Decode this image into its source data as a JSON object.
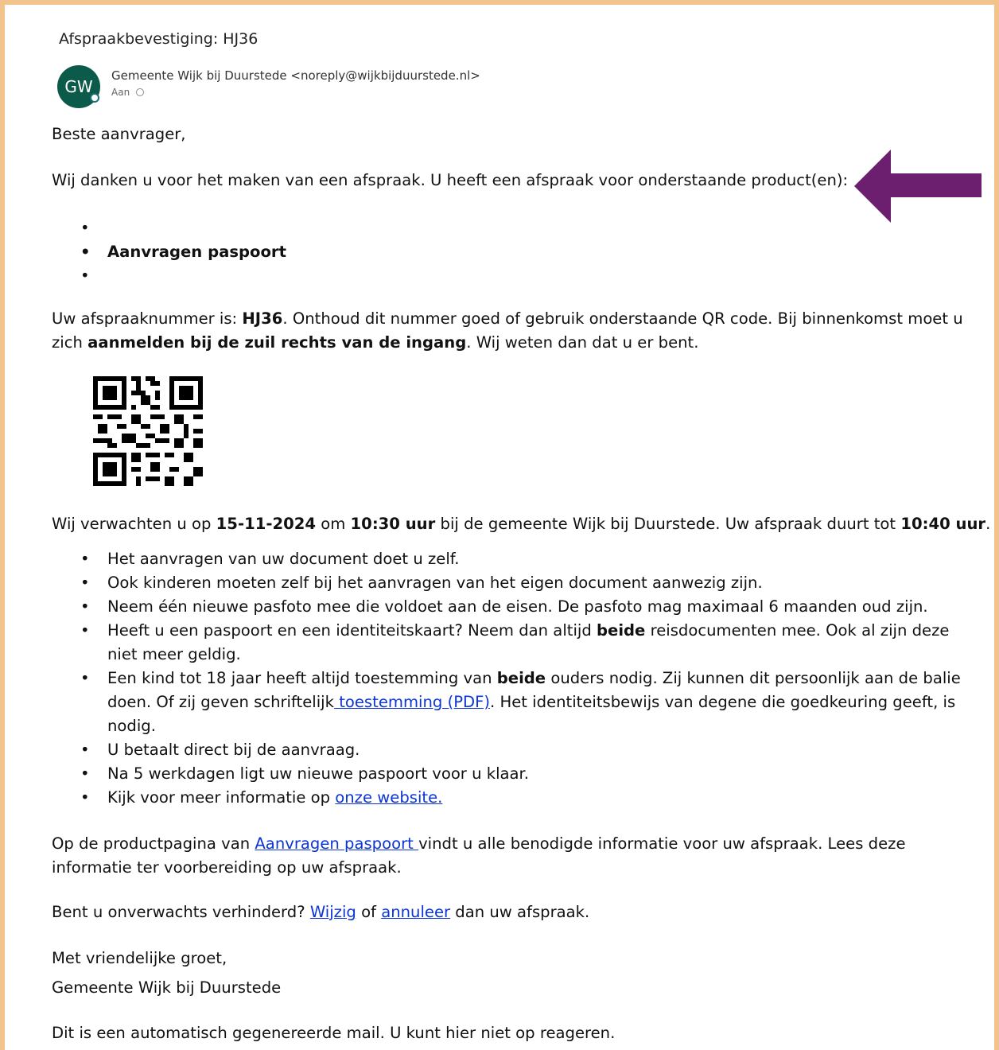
{
  "email": {
    "subject": "Afspraakbevestiging: HJ36",
    "avatar_initials": "GW",
    "sender": "Gemeente Wijk bij Duurstede <noreply@wijkbijduurstede.nl>",
    "to_label": "Aan"
  },
  "body": {
    "greeting": "Beste aanvrager,",
    "thanks": "Wij danken u voor het maken van een afspraak. U heeft een afspraak voor onderstaande product(en):",
    "products": [
      "",
      "Aanvragen paspoort",
      ""
    ],
    "nummer": {
      "part1": "Uw afspraaknummer is: ",
      "code": "HJ36",
      "part2": ". Onthoud dit nummer goed of gebruik onderstaande QR code. Bij binnenkomst moet u zich ",
      "bold": "aanmelden bij de zuil rechts van de ingang",
      "part3": ". Wij weten dan dat u er bent."
    },
    "verwacht": {
      "part1": "Wij verwachten u op ",
      "date": "15-11-2024",
      "part2": " om ",
      "time": "10:30 uur",
      "part3": " bij de gemeente Wijk bij Duurstede. Uw afspraak duurt tot ",
      "end_time": "10:40 uur",
      "part4": "."
    },
    "info_items": {
      "item1": "Het aanvragen van uw document doet u zelf.",
      "item2": "Ook kinderen moeten zelf bij het aanvragen van het eigen document aanwezig zijn.",
      "item3": "Neem één nieuwe pasfoto mee die voldoet aan de eisen. De pasfoto mag maximaal 6 maanden oud zijn.",
      "item4_a": "Heeft u een paspoort en een identiteitskaart? Neem dan altijd ",
      "item4_bold": "beide",
      "item4_b": " reisdocumenten mee. Ook al zijn deze niet meer geldig.",
      "item5_a": "Een kind tot 18 jaar heeft altijd toestemming van ",
      "item5_bold": "beide",
      "item5_b": " ouders nodig. Zij kunnen dit persoonlijk aan de balie doen. Of zij geven schriftelijk",
      "item5_link": " toestemming (PDF)",
      "item5_c": ". Het identiteitsbewijs van degene die goedkeuring geeft, is nodig.",
      "item6": "U betaalt direct bij de aanvraag.",
      "item7": "Na 5 werkdagen ligt uw nieuwe paspoort voor u klaar.",
      "item8_a": "Kijk voor meer informatie op ",
      "item8_link": "onze website."
    },
    "productpagina": {
      "part1": "Op de productpagina van ",
      "link": "Aanvragen paspoort ",
      "part2": "vindt u alle benodigde informatie voor uw afspraak. Lees deze informatie ter voorbereiding op uw afspraak."
    },
    "verhinderd": {
      "part1": "Bent u onverwachts verhinderd? ",
      "link_wijzig": "Wijzig",
      "part2": " of ",
      "link_annuleer": "annuleer",
      "part3": " dan uw afspraak."
    },
    "closing": "Met vriendelijke groet,",
    "signature": "Gemeente Wijk bij Duurstede",
    "auto_note": "Dit is een automatisch gegenereerde mail. U kunt hier niet op reageren."
  },
  "colors": {
    "frame_border": "#f2c48c",
    "avatar_bg": "#0c5a4a",
    "arrow": "#6b1f6e",
    "link": "#0b35d6"
  },
  "icons": {
    "arrow": "left-arrow-icon",
    "qr": "qr-code-icon"
  }
}
